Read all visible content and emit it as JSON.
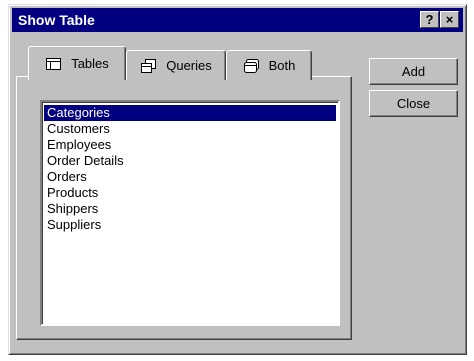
{
  "window": {
    "title": "Show Table"
  },
  "titlebar_buttons": {
    "help": "?",
    "close": "×"
  },
  "tabs": [
    {
      "label": "Tables",
      "icon": "table-icon",
      "active": true
    },
    {
      "label": "Queries",
      "icon": "query-icon",
      "active": false
    },
    {
      "label": "Both",
      "icon": "both-icon",
      "active": false
    }
  ],
  "list": {
    "items": [
      "Categories",
      "Customers",
      "Employees",
      "Order Details",
      "Orders",
      "Products",
      "Shippers",
      "Suppliers"
    ],
    "selected": "Categories"
  },
  "buttons": {
    "add_label": "Add",
    "close_label": "Close"
  },
  "colors": {
    "titlebar": "#000080",
    "face": "#c0c0c0",
    "selection": "#000080"
  }
}
